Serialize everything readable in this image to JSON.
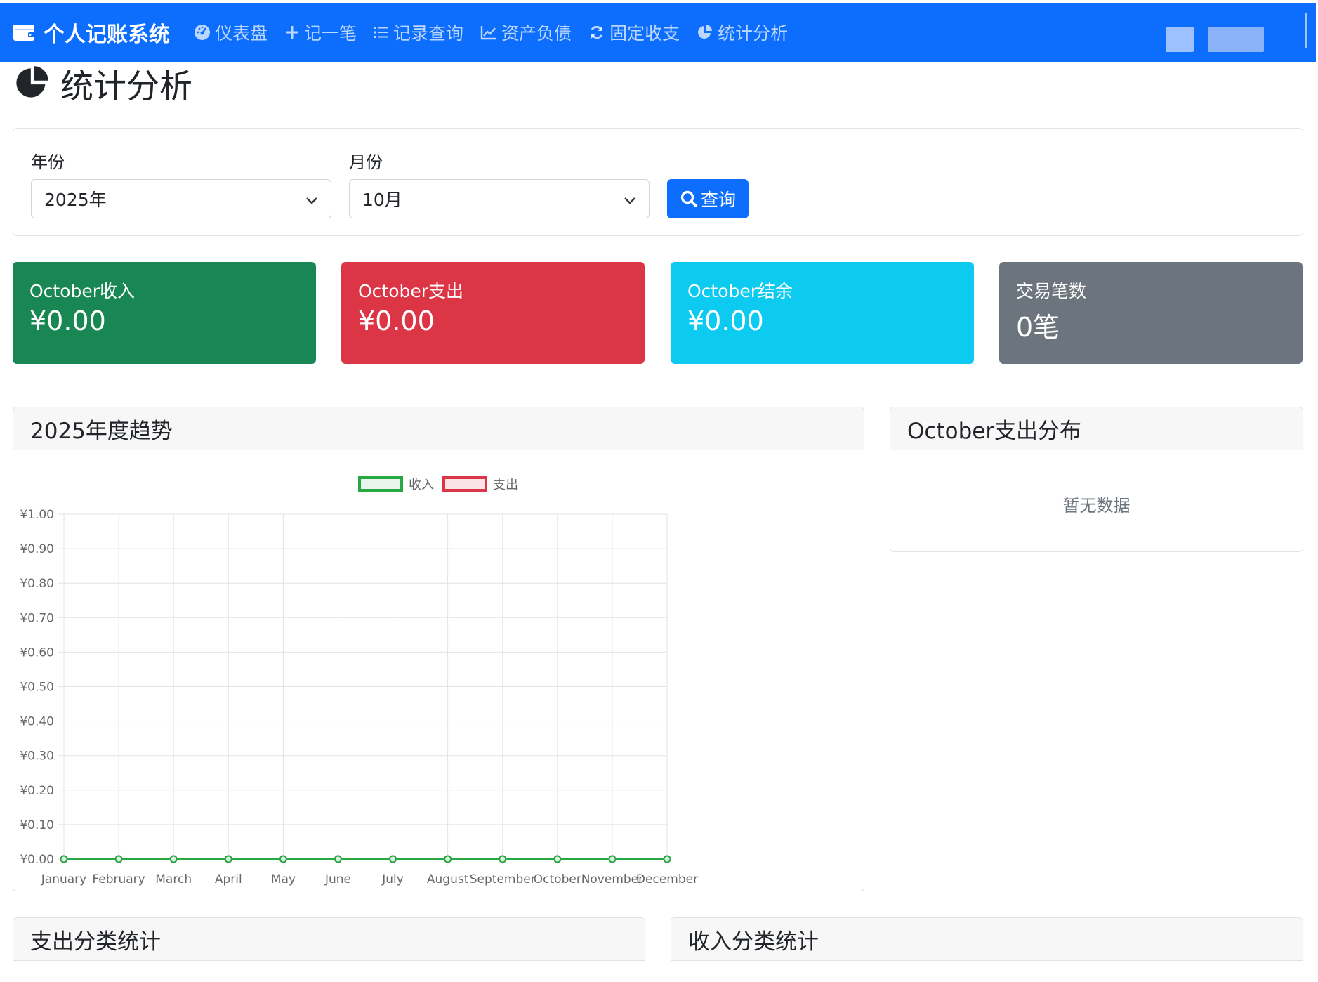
{
  "app": {
    "brand": "个人记账系统",
    "brand_icon": "wallet-icon"
  },
  "nav": [
    {
      "label": "仪表盘",
      "icon": "speedometer-icon"
    },
    {
      "label": "记一笔",
      "icon": "plus-icon"
    },
    {
      "label": "记录查询",
      "icon": "list-icon"
    },
    {
      "label": "资产负债",
      "icon": "line-chart-icon"
    },
    {
      "label": "固定收支",
      "icon": "refresh-icon"
    },
    {
      "label": "统计分析",
      "icon": "pie-chart-icon"
    }
  ],
  "page": {
    "title": "统计分析",
    "title_icon": "pie-chart-icon"
  },
  "filter": {
    "year_label": "年份",
    "year_value": "2025年",
    "month_label": "月份",
    "month_value": "10月",
    "query_label": "查询"
  },
  "stats": [
    {
      "label": "October收入",
      "value": "¥0.00",
      "color": "#198754"
    },
    {
      "label": "October支出",
      "value": "¥0.00",
      "color": "#dc3545"
    },
    {
      "label": "October结余",
      "value": "¥0.00",
      "color": "#0dcaf0"
    },
    {
      "label": "交易笔数",
      "value": "0笔",
      "color": "#6c757d"
    }
  ],
  "trend_card": {
    "title": "2025年度趋势"
  },
  "dist_card": {
    "title": "October支出分布",
    "empty_text": "暂无数据"
  },
  "expense_category_card": {
    "title": "支出分类统计"
  },
  "income_category_card": {
    "title": "收入分类统计"
  },
  "chart_data": {
    "type": "line",
    "categories": [
      "January",
      "February",
      "March",
      "April",
      "May",
      "June",
      "July",
      "August",
      "September",
      "October",
      "November",
      "December"
    ],
    "series": [
      {
        "name": "收入",
        "values": [
          0,
          0,
          0,
          0,
          0,
          0,
          0,
          0,
          0,
          0,
          0,
          0
        ],
        "color": "#28a745"
      },
      {
        "name": "支出",
        "values": [
          0,
          0,
          0,
          0,
          0,
          0,
          0,
          0,
          0,
          0,
          0,
          0
        ],
        "color": "#dc3545"
      }
    ],
    "yticks": [
      "¥0.00",
      "¥0.10",
      "¥0.20",
      "¥0.30",
      "¥0.40",
      "¥0.50",
      "¥0.60",
      "¥0.70",
      "¥0.80",
      "¥0.90",
      "¥1.00"
    ],
    "ylim": [
      0,
      1
    ],
    "grid": true,
    "legend_position": "top"
  }
}
